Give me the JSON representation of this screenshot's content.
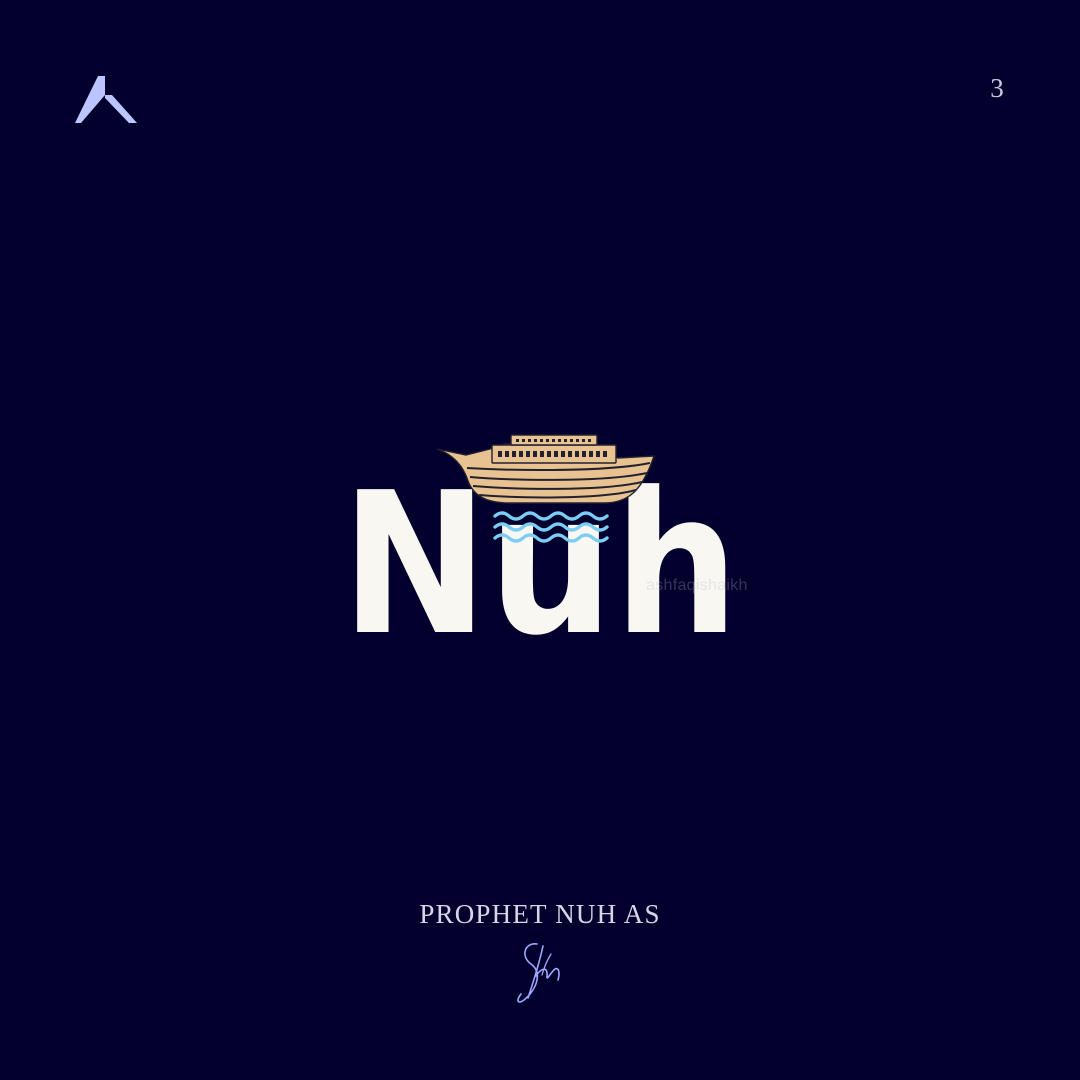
{
  "page": {
    "number": "3",
    "background": "#03002e"
  },
  "corner_logo": {
    "text": "人",
    "icon": "ren-character-logo-icon",
    "color": "#bcc5ff"
  },
  "logo": {
    "word": "Nuh",
    "word_color": "#f8f7f1",
    "ark_color": "#e8c391",
    "ark_outline": "#232030",
    "wave_color": "#7ccdf4",
    "icons": [
      "ark-icon",
      "waves-icon"
    ]
  },
  "watermark": "ashfaqishaikh",
  "caption": "PROPHET NUH AS",
  "signature": {
    "icon": "signature-icon",
    "color": "#9fa8ff"
  }
}
